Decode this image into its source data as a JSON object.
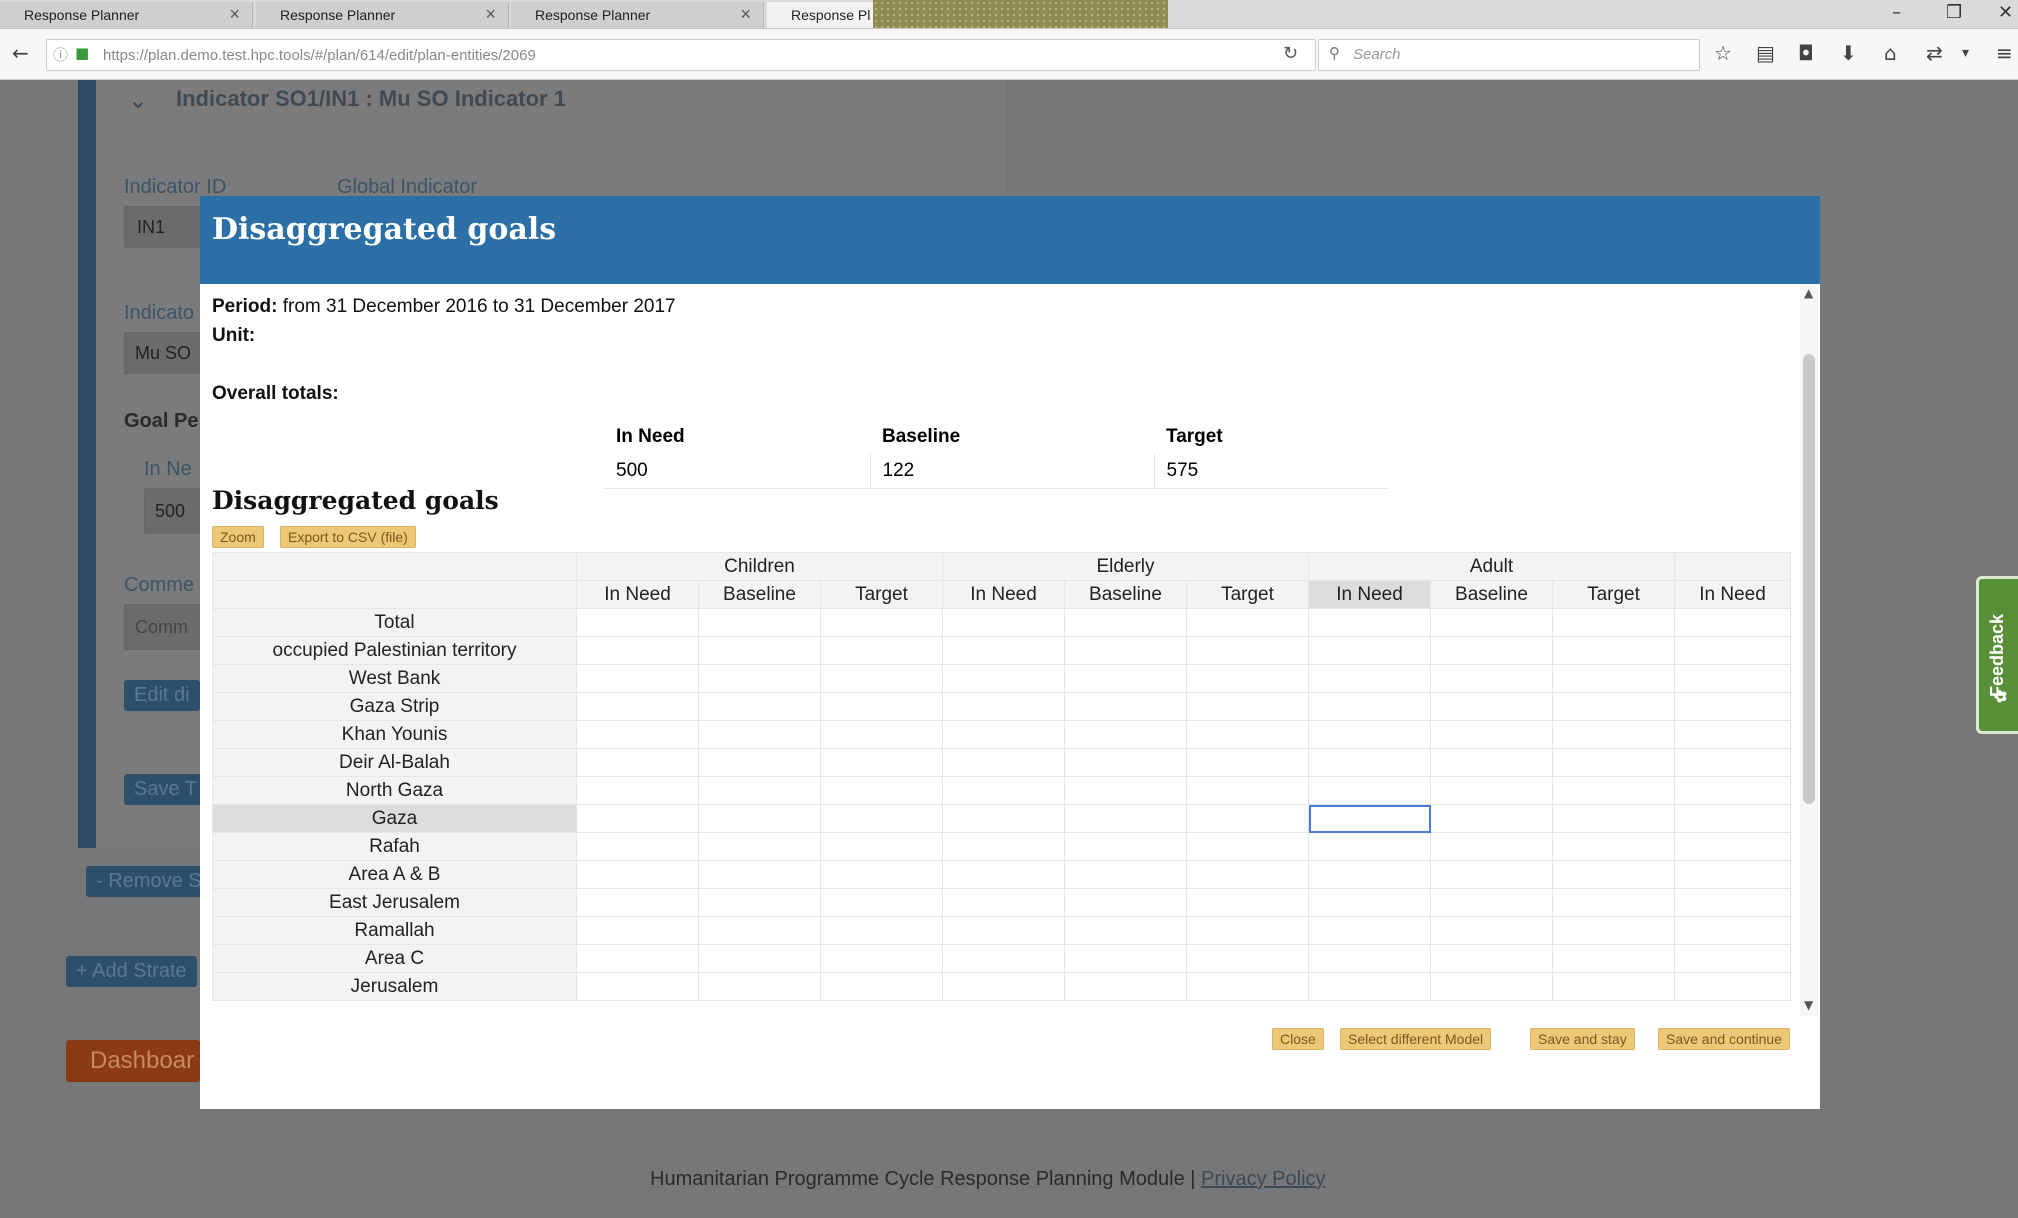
{
  "browser": {
    "tabs": [
      {
        "title": "Response Planner"
      },
      {
        "title": "Response Planner"
      },
      {
        "title": "Response Planner"
      },
      {
        "title": "Response Pl"
      }
    ],
    "url": "https://plan.demo.test.hpc.tools/#/plan/614/edit/plan-entities/2069",
    "search_placeholder": "Search"
  },
  "page": {
    "indicator_heading": "Indicator SO1/IN1 : Mu SO Indicator 1",
    "indicator_id_label": "Indicator ID",
    "global_indicator_label": "Global Indicator",
    "indicator_id_value": "IN1",
    "indicator_label": "Indicato",
    "indicator_value": "Mu SO",
    "goal_label": "Goal Pe",
    "in_need_label": "In Ne",
    "in_need_value": "500",
    "comments_label": "Comme",
    "comments_value": "Comm",
    "edit_button": "Edit di",
    "save_button": "Save T",
    "remove_button": "- Remove S",
    "add_strategy_button": "+ Add Strate",
    "dashboard_button": "Dashboar",
    "footer_text": "Humanitarian Programme Cycle Response Planning Module",
    "footer_sep": "|",
    "privacy_link": "Privacy Policy",
    "feedback_label": "Feedback"
  },
  "modal": {
    "title": "Disaggregated goals",
    "period_label": "Period:",
    "period_value": "from 31 December 2016 to 31 December 2017",
    "unit_label": "Unit:",
    "overall_totals_label": "Overall totals:",
    "totals": {
      "headers": [
        "In Need",
        "Baseline",
        "Target"
      ],
      "values": [
        "500",
        "122",
        "575"
      ]
    },
    "section_title": "Disaggregated goals",
    "zoom_button": "Zoom",
    "export_button": "Export to CSV (file)",
    "grid": {
      "groups": [
        "Children",
        "Elderly",
        "Adult"
      ],
      "subheaders": [
        "In Need",
        "Baseline",
        "Target",
        "In Need",
        "Baseline",
        "Target",
        "In Need",
        "Baseline",
        "Target",
        "In Need"
      ],
      "rows": [
        "Total",
        "occupied Palestinian territory",
        "West Bank",
        "Gaza Strip",
        "Khan Younis",
        "Deir Al-Balah",
        "North Gaza",
        "Gaza",
        "Rafah",
        "Area A & B",
        "East Jerusalem",
        "Ramallah",
        "Area C",
        "Jerusalem"
      ]
    },
    "footer_buttons": {
      "close": "Close",
      "select_model": "Select different Model",
      "save_stay": "Save and stay",
      "save_continue": "Save and continue"
    }
  }
}
